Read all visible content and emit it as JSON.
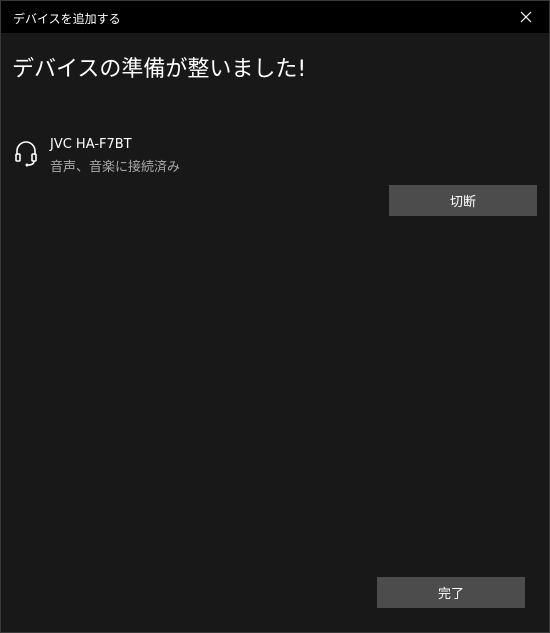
{
  "window": {
    "title": "デバイスを追加する",
    "close_icon": "close-icon"
  },
  "main": {
    "heading": "デバイスの準備が整いました!",
    "device": {
      "icon": "headset-icon",
      "name": "JVC HA-F7BT",
      "status": "音声、音楽に接続済み"
    },
    "disconnect_label": "切断",
    "done_label": "完了"
  },
  "colors": {
    "titlebar_bg": "#000000",
    "window_bg": "#181818",
    "button_bg": "#4c4c4c",
    "text_primary": "#ffffff",
    "text_secondary": "#a8a8a8"
  }
}
